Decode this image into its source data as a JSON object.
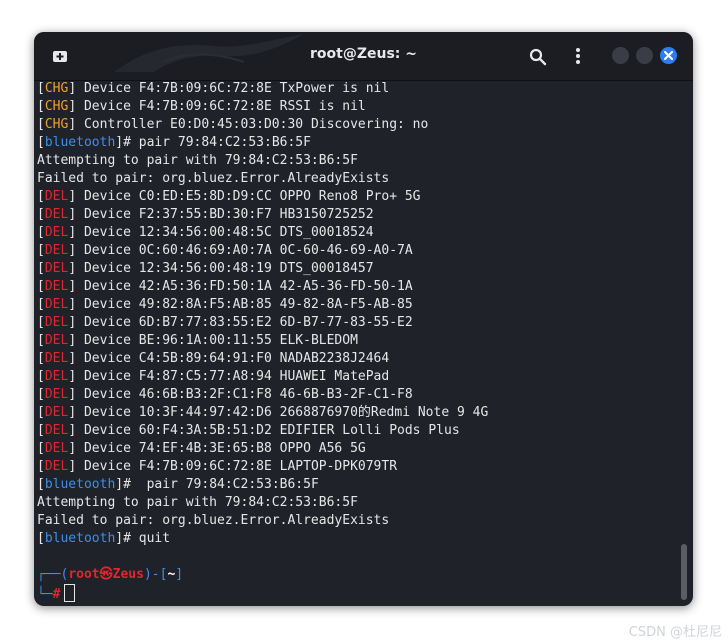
{
  "window": {
    "title": "root@Zeus: ~"
  },
  "icons": {
    "new_tab": "new-tab-icon",
    "search": "search-icon",
    "menu": "kebab-menu-icon",
    "minimize": "minimize-icon",
    "maximize": "maximize-icon",
    "close": "close-icon"
  },
  "colors": {
    "chg": "#f0a030",
    "del": "#e0262e",
    "bluetooth": "#3f8ee8",
    "close_button": "#2d7cf0"
  },
  "terminal": {
    "lines": [
      {
        "tag": "CHG",
        "text": " Device F4:7B:09:6C:72:8E TxPower is nil"
      },
      {
        "tag": "CHG",
        "text": " Device F4:7B:09:6C:72:8E RSSI is nil"
      },
      {
        "tag": "CHG",
        "text": " Controller E0:D0:45:03:D0:30 Discovering: no"
      },
      {
        "tag": "bluetooth",
        "text": "# pair 79:84:C2:53:B6:5F"
      },
      {
        "tag": "",
        "text": "Attempting to pair with 79:84:C2:53:B6:5F"
      },
      {
        "tag": "",
        "text": "Failed to pair: org.bluez.Error.AlreadyExists"
      },
      {
        "tag": "DEL",
        "text": " Device C0:ED:E5:8D:D9:CC OPPO Reno8 Pro+ 5G"
      },
      {
        "tag": "DEL",
        "text": " Device F2:37:55:BD:30:F7 HB3150725252"
      },
      {
        "tag": "DEL",
        "text": " Device 12:34:56:00:48:5C DTS_00018524"
      },
      {
        "tag": "DEL",
        "text": " Device 0C:60:46:69:A0:7A 0C-60-46-69-A0-7A"
      },
      {
        "tag": "DEL",
        "text": " Device 12:34:56:00:48:19 DTS_00018457"
      },
      {
        "tag": "DEL",
        "text": " Device 42:A5:36:FD:50:1A 42-A5-36-FD-50-1A"
      },
      {
        "tag": "DEL",
        "text": " Device 49:82:8A:F5:AB:85 49-82-8A-F5-AB-85"
      },
      {
        "tag": "DEL",
        "text": " Device 6D:B7:77:83:55:E2 6D-B7-77-83-55-E2"
      },
      {
        "tag": "DEL",
        "text": " Device BE:96:1A:00:11:55 ELK-BLEDOM"
      },
      {
        "tag": "DEL",
        "text": " Device C4:5B:89:64:91:F0 NADAB2238J2464"
      },
      {
        "tag": "DEL",
        "text": " Device F4:87:C5:77:A8:94 HUAWEI MatePad"
      },
      {
        "tag": "DEL",
        "text": " Device 46:6B:B3:2F:C1:F8 46-6B-B3-2F-C1-F8"
      },
      {
        "tag": "DEL",
        "text": " Device 10:3F:44:97:42:D6 2668876970的Redmi Note 9 4G"
      },
      {
        "tag": "DEL",
        "text": " Device 60:F4:3A:5B:51:D2 EDIFIER Lolli Pods Plus"
      },
      {
        "tag": "DEL",
        "text": " Device 74:EF:4B:3E:65:B8 OPPO A56 5G"
      },
      {
        "tag": "DEL",
        "text": " Device F4:7B:09:6C:72:8E LAPTOP-DPK079TR"
      },
      {
        "tag": "bluetooth",
        "text": "#  pair 79:84:C2:53:B6:5F"
      },
      {
        "tag": "",
        "text": "Attempting to pair with 79:84:C2:53:B6:5F"
      },
      {
        "tag": "",
        "text": "Failed to pair: org.bluez.Error.AlreadyExists"
      },
      {
        "tag": "bluetooth",
        "text": "# quit"
      }
    ],
    "prompt": {
      "line1_open": "┌──(",
      "user": "root",
      "at": "㉿",
      "host": "Zeus",
      "mid": ")-[",
      "dir": "~",
      "close": "]",
      "line2_lead": "└─",
      "hash": "#"
    }
  },
  "watermark": "CSDN @杜尼尼"
}
